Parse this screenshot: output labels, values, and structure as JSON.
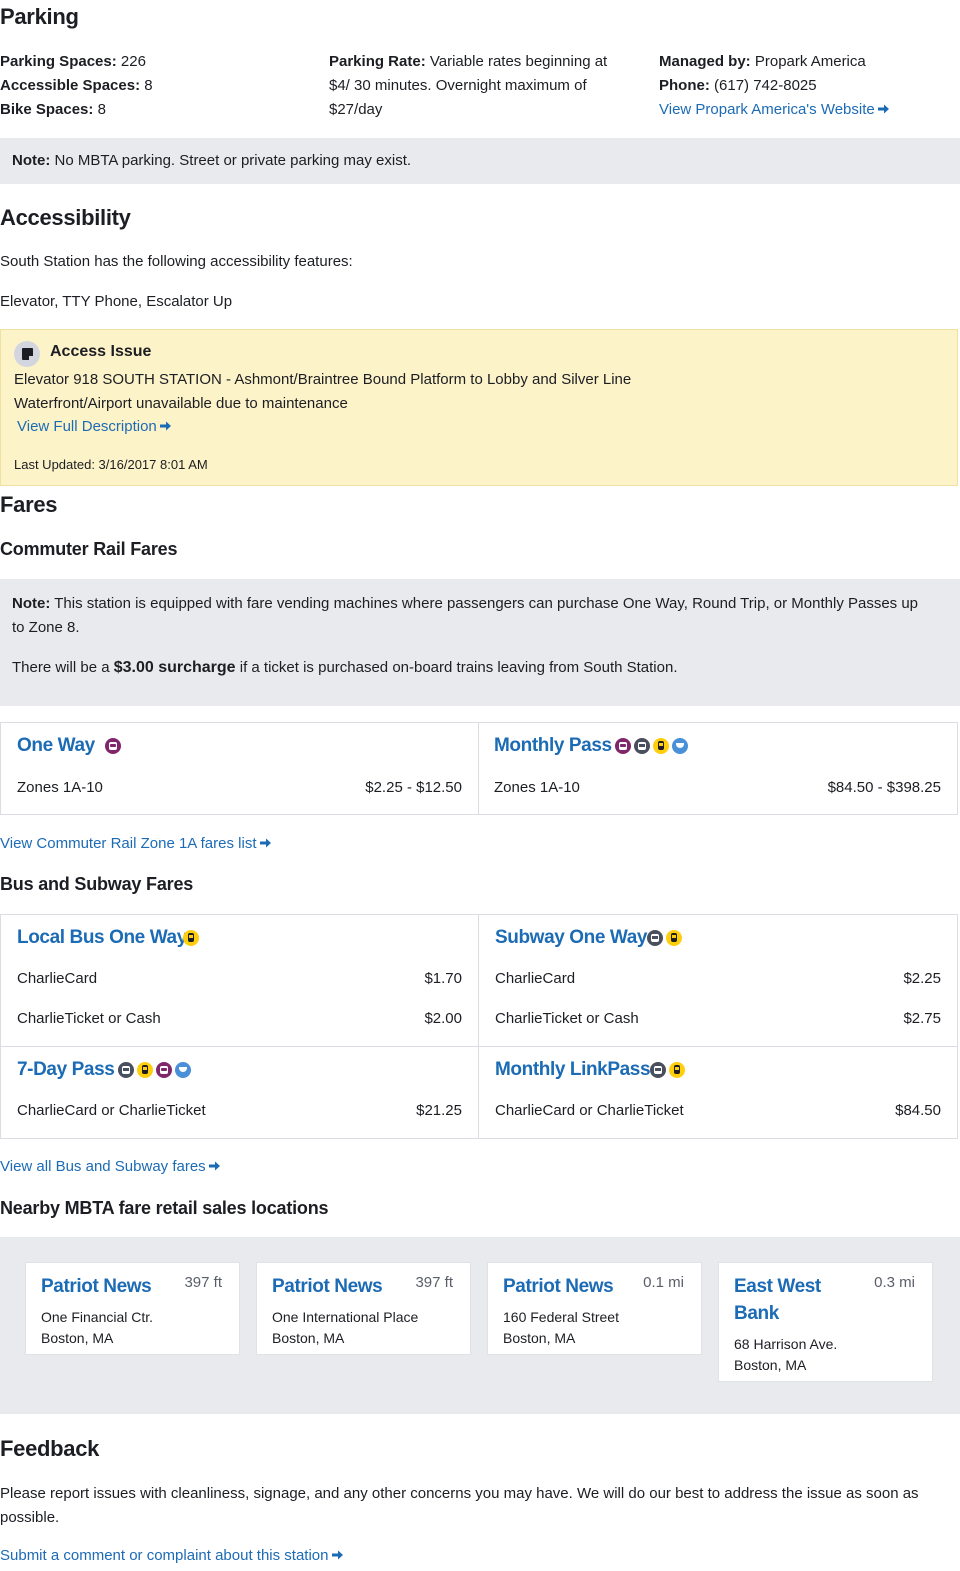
{
  "parking": {
    "heading": "Parking",
    "spaces_label": "Parking Spaces:",
    "spaces_value": "226",
    "accessible_label": "Accessible Spaces:",
    "accessible_value": "8",
    "bike_label": "Bike Spaces:",
    "bike_value": "8",
    "rate_label": "Parking Rate:",
    "rate_value_1": "Variable rates beginning at",
    "rate_value_2": "$4/ 30 minutes. Overnight maximum of",
    "rate_value_3": "$27/day",
    "managed_label": "Managed by:",
    "managed_value": "Propark America",
    "phone_label": "Phone:",
    "phone_value": "(617) 742-8025",
    "website_link": "View Propark America's Website",
    "note_label": "Note:",
    "note_text": "No MBTA parking. Street or private parking may exist."
  },
  "accessibility": {
    "heading": "Accessibility",
    "intro": "South Station has the following accessibility features:",
    "features": "Elevator, TTY Phone, Escalator Up",
    "alert": {
      "title": "Access Issue",
      "line1": "Elevator 918 SOUTH STATION - Ashmont/Braintree Bound Platform to Lobby and Silver Line",
      "line2": "Waterfront/Airport unavailable due to maintenance",
      "link": "View Full Description",
      "updated": "Last Updated: 3/16/2017 8:01 AM"
    }
  },
  "fares": {
    "heading": "Fares",
    "commuter_heading": "Commuter Rail Fares",
    "note_label": "Note:",
    "note_text_1": "This station is equipped with fare vending machines where passengers can purchase One Way, Round Trip, or Monthly Passes up",
    "note_text_2": "to Zone 8.",
    "surcharge_pre": "There will be a",
    "surcharge_bold": "$3.00 surcharge",
    "surcharge_post": "if a ticket is purchased on-board trains leaving from South Station.",
    "commuter_cards": [
      {
        "title": "One Way",
        "row_label": "Zones 1A-10",
        "row_price": "$2.25 - $12.50",
        "icons": [
          "commuter-rail-icon"
        ]
      },
      {
        "title": "Monthly Pass",
        "row_label": "Zones 1A-10",
        "row_price": "$84.50 - $398.25",
        "icons": [
          "commuter-rail-icon",
          "subway-icon",
          "bus-icon",
          "ferry-icon"
        ]
      }
    ],
    "commuter_link": "View Commuter Rail Zone 1A fares list",
    "bus_heading": "Bus and Subway Fares",
    "bus_cards": [
      {
        "title": "Local Bus One Way",
        "rows": [
          [
            "CharlieCard",
            "$1.70"
          ],
          [
            "CharlieTicket or Cash",
            "$2.00"
          ]
        ],
        "icons": [
          "bus-icon"
        ]
      },
      {
        "title": "Subway One Way",
        "rows": [
          [
            "CharlieCard",
            "$2.25"
          ],
          [
            "CharlieTicket or Cash",
            "$2.75"
          ]
        ],
        "icons": [
          "subway-icon",
          "bus-icon"
        ]
      },
      {
        "title": "7-Day Pass",
        "rows": [
          [
            "CharlieCard or CharlieTicket",
            "$21.25"
          ]
        ],
        "icons": [
          "subway-icon",
          "bus-icon",
          "commuter-rail-icon",
          "ferry-icon"
        ]
      },
      {
        "title": "Monthly LinkPass",
        "rows": [
          [
            "CharlieCard or CharlieTicket",
            "$84.50"
          ]
        ],
        "icons": [
          "subway-icon",
          "bus-icon"
        ]
      }
    ],
    "bus_link": "View all Bus and Subway fares"
  },
  "retail": {
    "heading": "Nearby MBTA fare retail sales locations",
    "locations": [
      {
        "name": "Patriot News",
        "distance": "397 ft",
        "addr1": "One Financial Ctr.",
        "addr2": "Boston, MA"
      },
      {
        "name": "Patriot News",
        "distance": "397 ft",
        "addr1": "One International Place",
        "addr2": "Boston, MA"
      },
      {
        "name": "Patriot News",
        "distance": "0.1 mi",
        "addr1": "160 Federal Street",
        "addr2": "Boston, MA"
      },
      {
        "name_1": "East West",
        "name_2": "Bank",
        "distance": "0.3 mi",
        "addr1": "68 Harrison Ave.",
        "addr2": "Boston, MA"
      }
    ]
  },
  "feedback": {
    "heading": "Feedback",
    "text_1": "Please report issues with cleanliness, signage, and any other concerns you may have. We will do our best to address the issue as soon as",
    "text_2": "possible.",
    "link": "Submit a comment or complaint about this station"
  },
  "colors": {
    "link": "#1c6bb5",
    "note_bg": "#e9eaed",
    "alert_bg": "#fdf3c9",
    "commuter_rail": "#80276c",
    "subway": "#494f5c",
    "bus": "#ffce0c",
    "ferry": "#4a90d9"
  }
}
